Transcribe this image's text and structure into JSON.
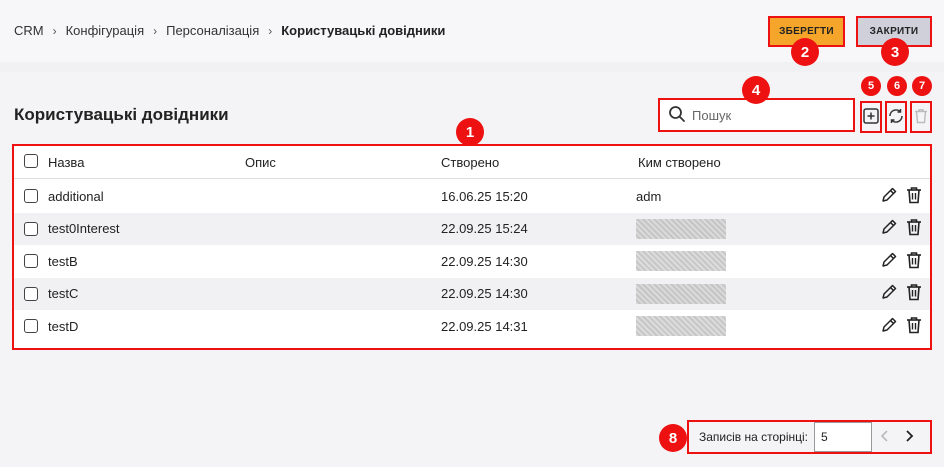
{
  "breadcrumb": {
    "items": [
      "CRM",
      "Конфігурація",
      "Персоналізація"
    ],
    "separator": "›",
    "current": "Користувацькі довідники"
  },
  "toolbar": {
    "save_label": "ЗБЕРЕГТИ",
    "close_label": "ЗАКРИТИ"
  },
  "page": {
    "title": "Користувацькі довідники"
  },
  "search": {
    "placeholder": "Пошук"
  },
  "icons": {
    "search": "search-icon",
    "add": "plus-square-icon",
    "refresh": "refresh-icon",
    "delete": "trash-icon",
    "edit": "pencil-icon",
    "prev": "chevron-left-icon",
    "next": "chevron-right-icon"
  },
  "table": {
    "columns": [
      "Назва",
      "Опис",
      "Створено",
      "Ким створено"
    ],
    "rows": [
      {
        "name": "additional",
        "description": "",
        "created": "16.06.25 15:20",
        "created_by": "adm",
        "author_redacted": false
      },
      {
        "name": "test0Interest",
        "description": "",
        "created": "22.09.25 15:24",
        "created_by": "",
        "author_redacted": true
      },
      {
        "name": "testB",
        "description": "",
        "created": "22.09.25 14:30",
        "created_by": "",
        "author_redacted": true
      },
      {
        "name": "testC",
        "description": "",
        "created": "22.09.25 14:30",
        "created_by": "",
        "author_redacted": true
      },
      {
        "name": "testD",
        "description": "",
        "created": "22.09.25 14:31",
        "created_by": "",
        "author_redacted": true
      }
    ]
  },
  "pagination": {
    "label": "Записів на сторінці:",
    "value": "5"
  },
  "annotations": [
    "1",
    "2",
    "3",
    "4",
    "5",
    "6",
    "7",
    "8"
  ],
  "colors": {
    "accent": "#f4a52a",
    "close_button": "#cfd0da",
    "annotation": "#ee1111"
  }
}
